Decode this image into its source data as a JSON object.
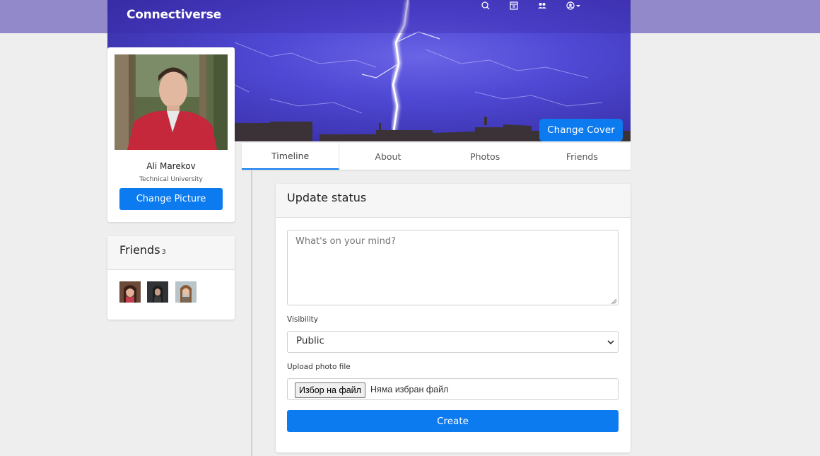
{
  "navbar": {
    "brand": "Connectiverse",
    "icons": [
      "search-icon",
      "calendar-icon",
      "people-icon",
      "user-menu-icon"
    ]
  },
  "cover": {
    "change_cover_label": "Change Cover"
  },
  "profile": {
    "name": "Ali Marekov",
    "subtitle": "Technical University",
    "change_picture_label": "Change Picture"
  },
  "friends": {
    "title": "Friends",
    "count": "3"
  },
  "tabs": [
    {
      "label": "Timeline",
      "active": true
    },
    {
      "label": "About",
      "active": false
    },
    {
      "label": "Photos",
      "active": false
    },
    {
      "label": "Friends",
      "active": false
    }
  ],
  "status": {
    "title": "Update status",
    "placeholder": "What's on your mind?",
    "visibility_label": "Visibility",
    "visibility_value": "Public",
    "upload_label": "Upload photo file",
    "file_button": "Избор на файл",
    "file_status": "Няма избран файл",
    "create_label": "Create"
  },
  "colors": {
    "primary": "#0d7bf0",
    "top_band": "#9289cb",
    "background": "#eeeeee"
  }
}
